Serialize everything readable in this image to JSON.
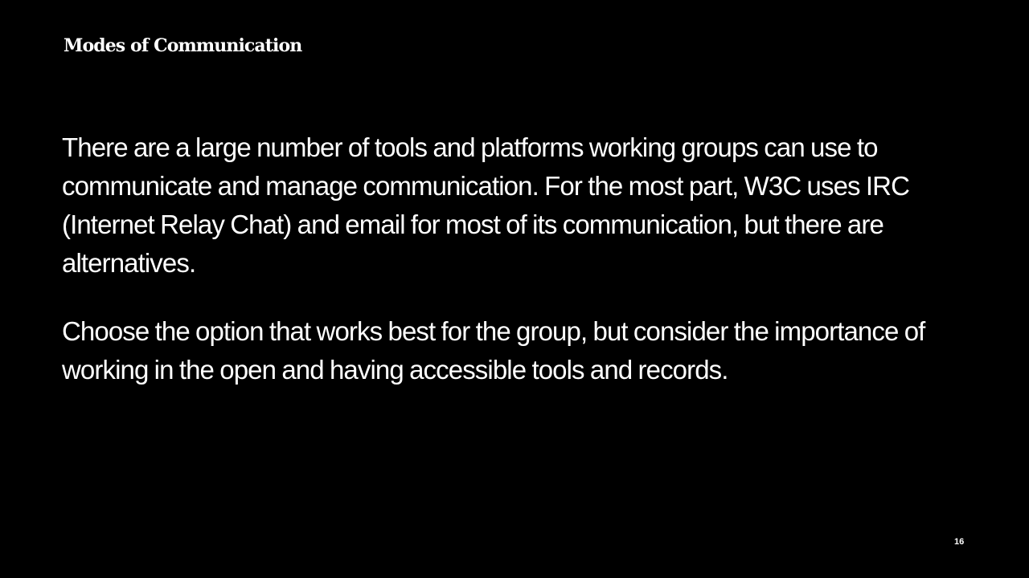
{
  "slide": {
    "title": "Modes of Communication",
    "paragraphs": [
      "There are a large number of tools and platforms working groups can use to communicate and manage communication. For the most part, W3C uses IRC (Internet Relay Chat) and email for most of its communication, but there are alternatives.",
      "Choose the option that works best for the group, but consider the importance of working in the open and having accessible tools and records."
    ],
    "page_number": "16"
  },
  "colors": {
    "background": "#000000",
    "text": "#ffffff"
  }
}
